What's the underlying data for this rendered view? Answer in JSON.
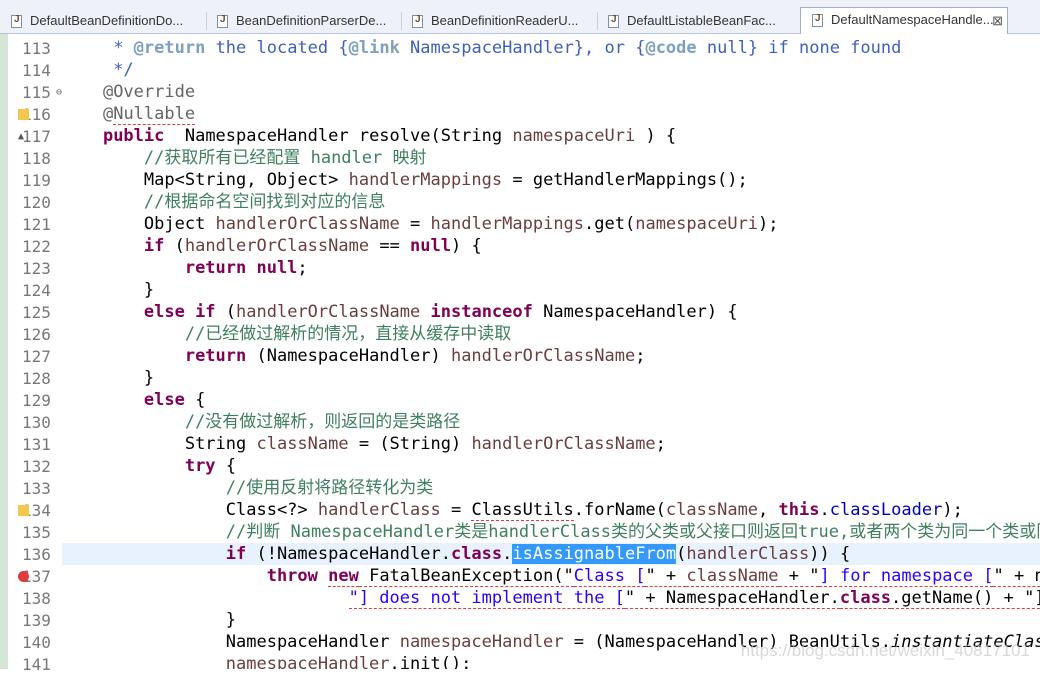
{
  "tabs": [
    {
      "label": "DefaultBeanDefinitionDo...",
      "active": false
    },
    {
      "label": "BeanDefinitionParserDe...",
      "active": false
    },
    {
      "label": "BeanDefinitionReaderU...",
      "active": false
    },
    {
      "label": "DefaultListableBeanFac...",
      "active": false
    },
    {
      "label": "DefaultNamespaceHandle...",
      "active": true
    }
  ],
  "close_glyph": "⊠",
  "lines": [
    {
      "n": "113",
      "indent": "     ",
      "t": [
        [
          "jd",
          "* "
        ],
        [
          "tag",
          "@return"
        ],
        [
          "jd",
          " the located {"
        ],
        [
          "tag",
          "@link"
        ],
        [
          "jd",
          " NamespaceHandler}, or {"
        ],
        [
          "tag",
          "@code"
        ],
        [
          "jd",
          " null} if none found"
        ]
      ]
    },
    {
      "n": "114",
      "indent": "     ",
      "t": [
        [
          "jd",
          "*/"
        ]
      ]
    },
    {
      "n": "115",
      "indent": "    ",
      "t": [
        [
          "an",
          "@Override"
        ]
      ]
    },
    {
      "n": "116",
      "indent": "    ",
      "t": [
        [
          "an",
          "@"
        ],
        [
          "an err",
          "Nullable"
        ]
      ]
    },
    {
      "n": "117",
      "indent": "    ",
      "t": [
        [
          "kw",
          "public"
        ],
        [
          "",
          "  NamespaceHandler resolve(String "
        ],
        [
          "vr",
          "namespaceUri"
        ],
        [
          "",
          " ) {"
        ]
      ]
    },
    {
      "n": "118",
      "indent": "        ",
      "t": [
        [
          "cm",
          "//获取所有已经配置 handler 映射"
        ]
      ]
    },
    {
      "n": "119",
      "indent": "        ",
      "t": [
        [
          "",
          "Map<String, Object> "
        ],
        [
          "vr",
          "handlerMappings"
        ],
        [
          "",
          " = getHandlerMappings();"
        ]
      ]
    },
    {
      "n": "120",
      "indent": "        ",
      "t": [
        [
          "cm",
          "//根据命名空间找到对应的信息"
        ]
      ]
    },
    {
      "n": "121",
      "indent": "        ",
      "t": [
        [
          "",
          "Object "
        ],
        [
          "vr",
          "handlerOrClassName"
        ],
        [
          "",
          " = "
        ],
        [
          "vr",
          "handlerMappings"
        ],
        [
          "",
          ".get("
        ],
        [
          "vr",
          "namespaceUri"
        ],
        [
          "",
          ");"
        ]
      ]
    },
    {
      "n": "122",
      "indent": "        ",
      "t": [
        [
          "kw",
          "if"
        ],
        [
          "",
          " ("
        ],
        [
          "vr",
          "handlerOrClassName"
        ],
        [
          "",
          " == "
        ],
        [
          "kw",
          "null"
        ],
        [
          "",
          ") {"
        ]
      ]
    },
    {
      "n": "123",
      "indent": "            ",
      "t": [
        [
          "kw",
          "return null"
        ],
        [
          "",
          ";"
        ]
      ]
    },
    {
      "n": "124",
      "indent": "        ",
      "t": [
        [
          "",
          "}"
        ]
      ]
    },
    {
      "n": "125",
      "indent": "        ",
      "t": [
        [
          "kw",
          "else if"
        ],
        [
          "",
          " ("
        ],
        [
          "vr",
          "handlerOrClassName"
        ],
        [
          "",
          " "
        ],
        [
          "kw",
          "instanceof"
        ],
        [
          "",
          " NamespaceHandler) {"
        ]
      ]
    },
    {
      "n": "126",
      "indent": "            ",
      "t": [
        [
          "cm",
          "//已经做过解析的情况，直接从缓存中读取"
        ]
      ]
    },
    {
      "n": "127",
      "indent": "            ",
      "t": [
        [
          "kw",
          "return"
        ],
        [
          "",
          " (NamespaceHandler) "
        ],
        [
          "vr",
          "handlerOrClassName"
        ],
        [
          "",
          ";"
        ]
      ]
    },
    {
      "n": "128",
      "indent": "        ",
      "t": [
        [
          "",
          "}"
        ]
      ]
    },
    {
      "n": "129",
      "indent": "        ",
      "t": [
        [
          "kw",
          "else"
        ],
        [
          "",
          " {"
        ]
      ]
    },
    {
      "n": "130",
      "indent": "            ",
      "t": [
        [
          "cm",
          "//没有做过解析，则返回的是类路径"
        ]
      ]
    },
    {
      "n": "131",
      "indent": "            ",
      "t": [
        [
          "",
          "String "
        ],
        [
          "vr",
          "className"
        ],
        [
          "",
          " = (String) "
        ],
        [
          "vr",
          "handlerOrClassName"
        ],
        [
          "",
          ";"
        ]
      ]
    },
    {
      "n": "132",
      "indent": "            ",
      "t": [
        [
          "kw",
          "try"
        ],
        [
          "",
          " {"
        ]
      ]
    },
    {
      "n": "133",
      "indent": "                ",
      "t": [
        [
          "cm",
          "//使用反射将路径转化为类"
        ]
      ]
    },
    {
      "n": "134",
      "indent": "                ",
      "t": [
        [
          "",
          "Class<?> "
        ],
        [
          "vr",
          "handlerClass"
        ],
        [
          "",
          " = "
        ],
        [
          "err",
          "ClassUtils"
        ],
        [
          "",
          ".forName("
        ],
        [
          "vr",
          "className"
        ],
        [
          "",
          ", "
        ],
        [
          "kw",
          "this"
        ],
        [
          "",
          "."
        ],
        [
          "fld",
          "classLoader"
        ],
        [
          "",
          ");"
        ]
      ]
    },
    {
      "n": "135",
      "indent": "                ",
      "t": [
        [
          "cm",
          "//判断 NamespaceHandler类是handlerClass类的父类或父接口则返回true,或者两个类为同一个类或同一个接口"
        ]
      ]
    },
    {
      "n": "136",
      "indent": "                ",
      "t": [
        [
          "kw",
          "if"
        ],
        [
          "",
          " (!NamespaceHandler."
        ],
        [
          "kw",
          "class"
        ],
        [
          "",
          "."
        ],
        [
          "sel",
          "isAssignableFrom"
        ],
        [
          "",
          "("
        ],
        [
          "vr",
          "handlerClass"
        ],
        [
          "",
          ")) {"
        ]
      ]
    },
    {
      "n": "137",
      "indent": "                    ",
      "t": [
        [
          "kw",
          "throw"
        ],
        [
          "",
          " "
        ],
        [
          "kw err",
          "new"
        ],
        [
          "err",
          " FatalBeanException(\""
        ],
        [
          "str err",
          "Class ["
        ],
        [
          "err",
          "\" + "
        ],
        [
          "vr err",
          "className"
        ],
        [
          "err",
          " + \""
        ],
        [
          "str err",
          "] for namespace ["
        ],
        [
          "err",
          "\" + nam"
        ]
      ]
    },
    {
      "n": "138",
      "indent": "                            ",
      "t": [
        [
          "str err",
          "\"] does not implement the ["
        ],
        [
          "err",
          "\" + NamespaceHandler."
        ],
        [
          "kw err",
          "class"
        ],
        [
          "err",
          ".getName() + \"] i"
        ]
      ]
    },
    {
      "n": "139",
      "indent": "                ",
      "t": [
        [
          "",
          "}"
        ]
      ]
    },
    {
      "n": "140",
      "indent": "                ",
      "t": [
        [
          "",
          "NamespaceHandler "
        ],
        [
          "vr",
          "namespaceHandler"
        ],
        [
          "",
          " = (NamespaceHandler) BeanUtils."
        ],
        [
          "it",
          "instantiateClass"
        ],
        [
          "",
          "("
        ]
      ]
    },
    {
      "n": "141",
      "indent": "                ",
      "t": [
        [
          "vr",
          "namespaceHandler"
        ],
        [
          "",
          ".init();"
        ]
      ]
    }
  ],
  "watermark": "https://blog.csdn.net/weixin_40817101"
}
